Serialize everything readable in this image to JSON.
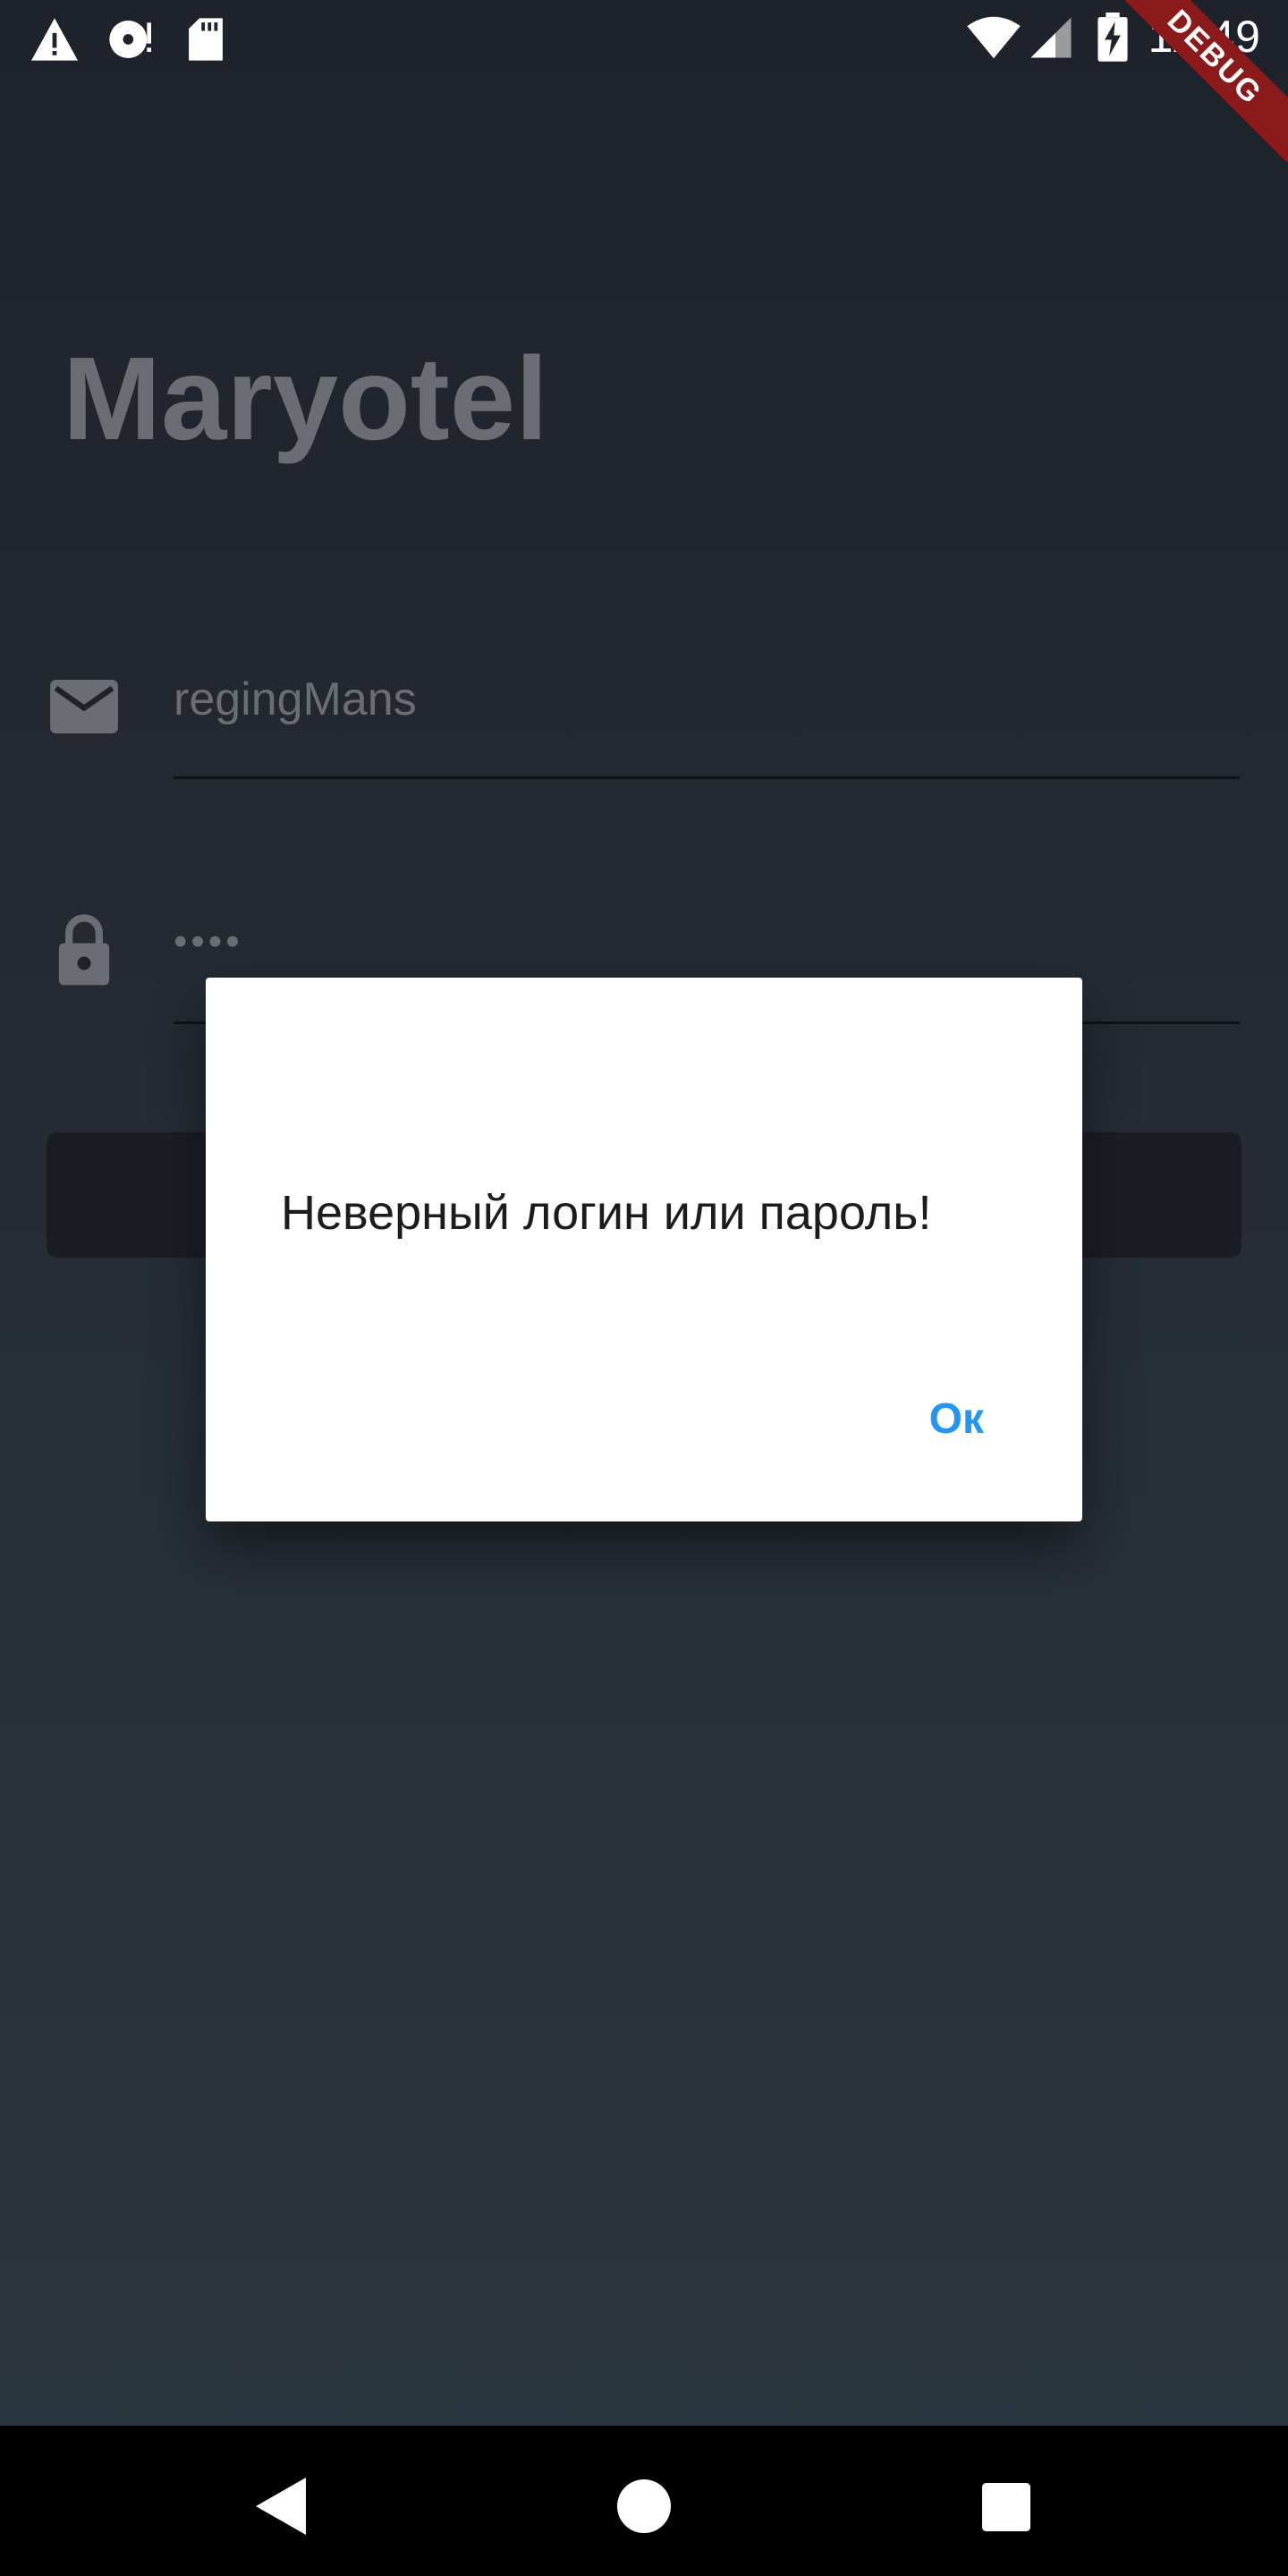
{
  "status_bar": {
    "time": "11:49",
    "debug_label": "DEBUG",
    "icons": [
      "warning-icon",
      "disc-icon",
      "sd-card-icon",
      "wifi-icon",
      "cell-signal-icon",
      "battery-charging-icon"
    ]
  },
  "app": {
    "title": "Maryotel",
    "email_field": {
      "icon": "mail-icon",
      "value": "regingMans"
    },
    "password_field": {
      "icon": "lock-icon",
      "value": "••••"
    },
    "login_button_label": ""
  },
  "dialog": {
    "message": "Неверный логин или пароль!",
    "ok_label": "Ок",
    "accent_color": "#2196f3"
  },
  "nav_bar": {
    "buttons": [
      "back-icon",
      "home-icon",
      "recents-icon"
    ]
  }
}
